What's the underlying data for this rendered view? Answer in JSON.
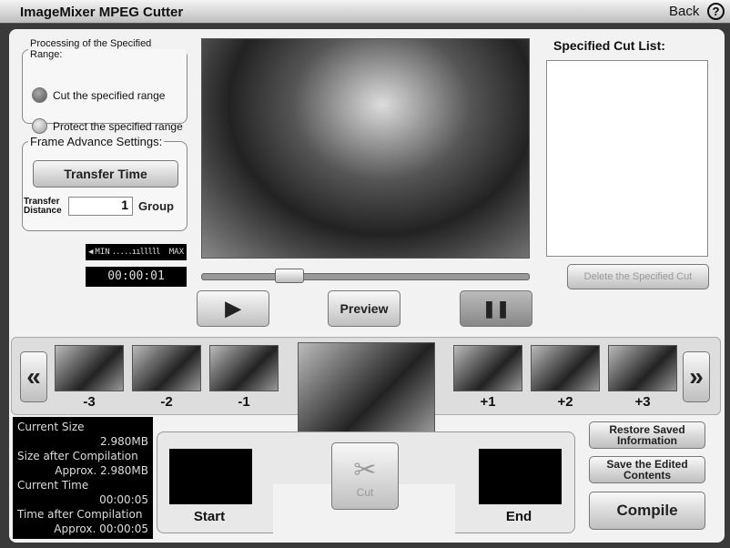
{
  "window": {
    "title": "ImageMixer MPEG Cutter",
    "back_label": "Back",
    "help_label": "?"
  },
  "processing": {
    "legend": "Processing of the Specified Range:",
    "options": [
      {
        "label": "Cut the specified range",
        "selected": true
      },
      {
        "label": "Protect the specified range",
        "selected": false
      }
    ]
  },
  "frame_advance": {
    "legend": "Frame Advance Settings:",
    "transfer_time_label": "Transfer Time",
    "distance_label_1": "Transfer",
    "distance_label_2": "Distance",
    "distance_value": "1",
    "unit": "Group"
  },
  "volume": {
    "min": "MIN",
    "max": "MAX",
    "level": 0.6
  },
  "timecode": "00:00:01",
  "seek_position": 0.27,
  "controls": {
    "play": "▶",
    "preview": "Preview",
    "pause": "❚❚"
  },
  "cut_list": {
    "title": "Specified Cut List:",
    "delete_label": "Delete the Specified Cut"
  },
  "frames": {
    "prev": "«",
    "next": "»",
    "labels": [
      "-3",
      "-2",
      "-1",
      "+1",
      "+2",
      "+3"
    ]
  },
  "info": {
    "current_size_label": "Current Size",
    "current_size": "2.980MB",
    "size_after_label": "Size after Compilation",
    "size_after": "Approx. 2.980MB",
    "current_time_label": "Current Time",
    "current_time": "00:00:05",
    "time_after_label": "Time after Compilation",
    "time_after": "Approx. 00:00:05"
  },
  "cut": {
    "start_label": "Start",
    "end_label": "End",
    "cut_label": "Cut"
  },
  "actions": {
    "restore": "Restore Saved Information",
    "save": "Save the Edited Contents",
    "compile": "Compile"
  }
}
